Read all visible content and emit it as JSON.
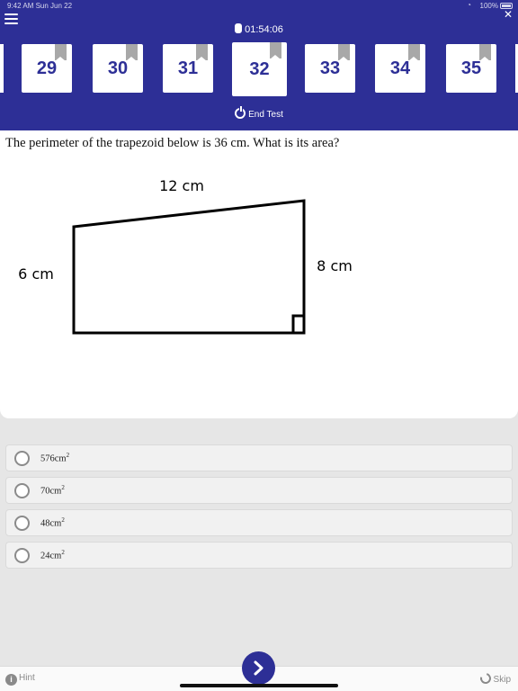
{
  "status_bar": {
    "time_date": "9:42 AM  Sun Jun 22",
    "battery": "100%"
  },
  "timer": {
    "value": "01:54:06"
  },
  "question_tabs": [
    {
      "number": "29",
      "bookmarked": true,
      "active": false
    },
    {
      "number": "30",
      "bookmarked": true,
      "active": false
    },
    {
      "number": "31",
      "bookmarked": true,
      "active": false
    },
    {
      "number": "32",
      "bookmarked": true,
      "active": true
    },
    {
      "number": "33",
      "bookmarked": true,
      "active": false
    },
    {
      "number": "34",
      "bookmarked": true,
      "active": false
    },
    {
      "number": "35",
      "bookmarked": true,
      "active": false
    }
  ],
  "end_test": {
    "label": "End Test"
  },
  "question": {
    "text": "The perimeter of the trapezoid below is 36 cm. What is its area?",
    "figure": {
      "top_label": "12 cm",
      "left_label": "6 cm",
      "right_label": "8 cm"
    }
  },
  "answers": [
    {
      "value": "576cm",
      "superscript": "2"
    },
    {
      "value": "70cm",
      "superscript": "2"
    },
    {
      "value": "48cm",
      "superscript": "2"
    },
    {
      "value": "24cm",
      "superscript": "2"
    }
  ],
  "footer": {
    "hint_label": "Hint",
    "skip_label": "Skip"
  },
  "colors": {
    "header_bg": "#2d2f96",
    "accent": "#2d2f96"
  }
}
